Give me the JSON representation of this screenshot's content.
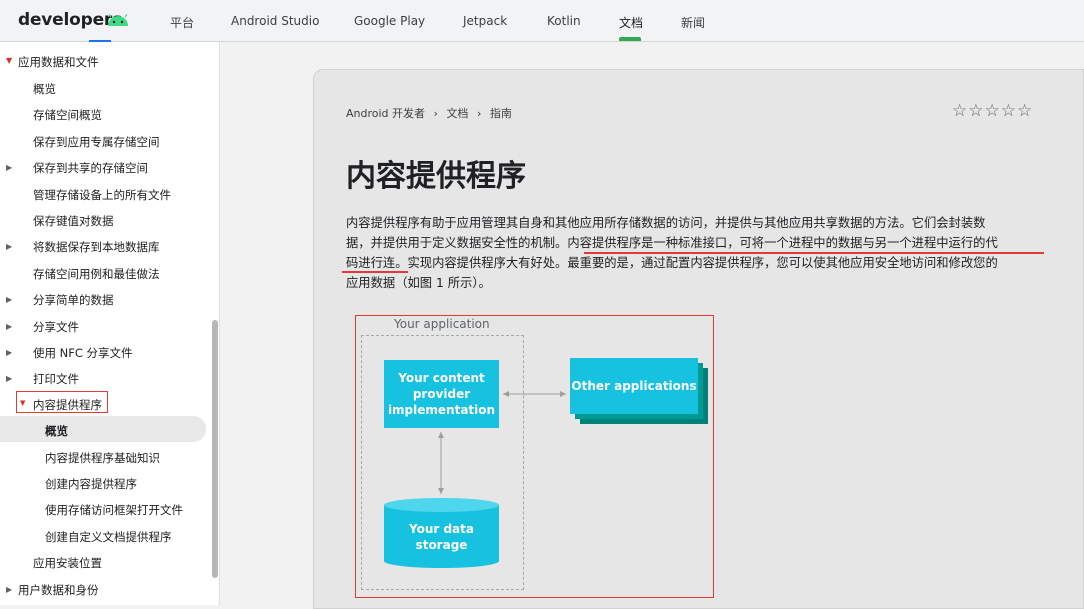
{
  "header": {
    "logo": "developers",
    "nav": [
      {
        "label": "平台"
      },
      {
        "label": "Android Studio"
      },
      {
        "label": "Google Play"
      },
      {
        "label": "Jetpack"
      },
      {
        "label": "Kotlin"
      },
      {
        "label": "文档",
        "active": true
      },
      {
        "label": "新闻"
      }
    ]
  },
  "sidebar": {
    "section": "应用数据和文件",
    "items": [
      "概览",
      "存储空间概览",
      "保存到应用专属存储空间",
      "保存到共享的存储空间",
      "管理存储设备上的所有文件",
      "保存键值对数据",
      "将数据保存到本地数据库",
      "存储空间用例和最佳做法",
      "分享简单的数据",
      "分享文件",
      "使用 NFC 分享文件",
      "打印文件",
      "内容提供程序"
    ],
    "sub_items": [
      "概览",
      "内容提供程序基础知识",
      "创建内容提供程序",
      "使用存储访问框架打开文件",
      "创建自定义文档提供程序"
    ],
    "after": "应用安装位置",
    "next_section": "用户数据和身份"
  },
  "breadcrumb": [
    "Android 开发者",
    "文档",
    "指南"
  ],
  "breadcrumb_sep": "›",
  "rating": "☆☆☆☆☆",
  "page": {
    "title": "内容提供程序",
    "paragraph_lines": [
      "内容提供程序有助于应用管理其自身和其他应用所存储数据的访问，并提供与其他应用共享数据的方法。它们会封装数",
      "据，并提供用于定义数据安全性的机制。内容提供程序是一种标准接口，可将一个进程中的数据与另一个进程中运行的代",
      "码进行连。实现内容提供程序大有好处。最重要的是，通过配置内容提供程序，您可以使其他应用安全地访问和修改您的",
      "应用数据（如图 1 所示）。"
    ]
  },
  "diagram": {
    "app_label": "Your application",
    "provider_label": "Your content provider implementation",
    "other_apps_label": "Other applications",
    "storage_label": "Your data storage"
  },
  "colors": {
    "accent_green": "#34a853",
    "accent_blue": "#1a73e8",
    "block_cyan": "#16c2df",
    "highlight_red": "#e53935"
  }
}
